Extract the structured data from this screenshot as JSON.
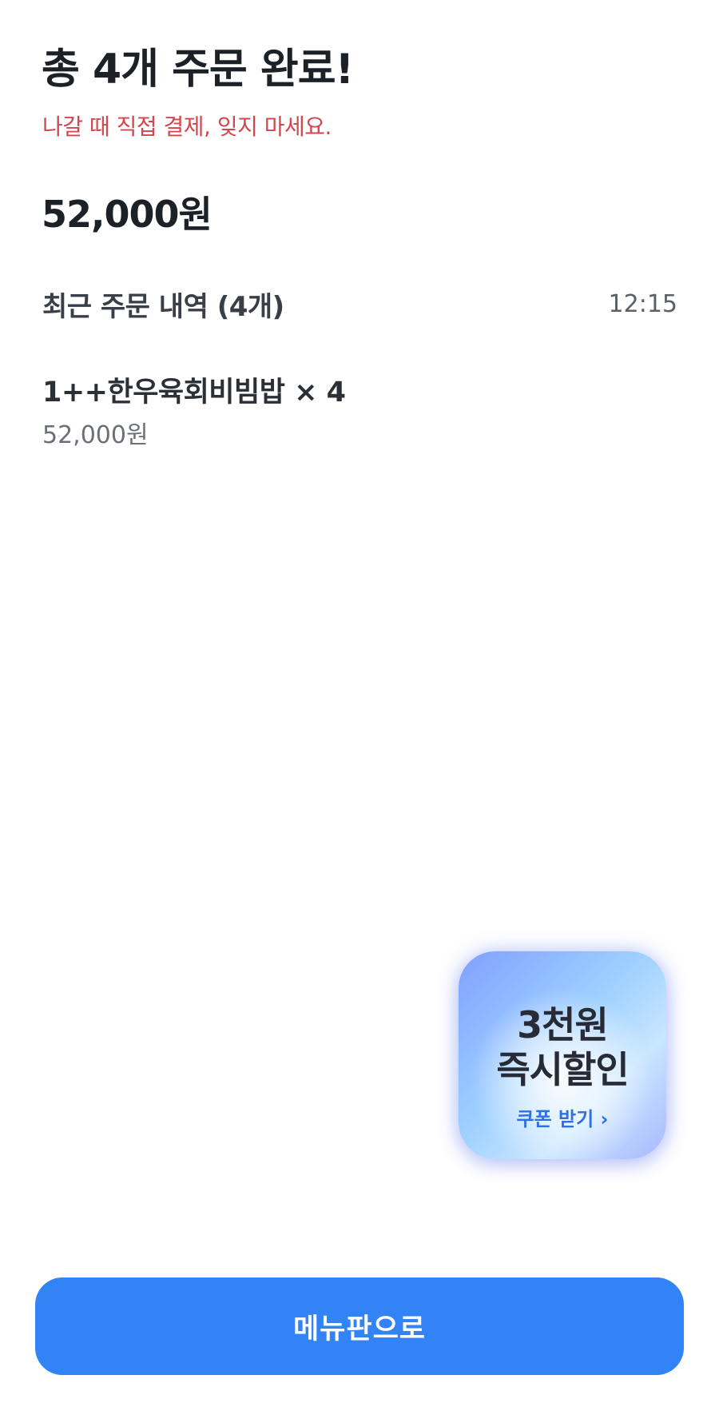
{
  "header": {
    "title": "총 4개 주문 완료!",
    "subtitle": "나갈 때 직접 결제, 잊지 마세요."
  },
  "summary": {
    "total_price": "52,000원"
  },
  "history": {
    "title": "최근 주문 내역 (4개)",
    "time": "12:15",
    "items": [
      {
        "name": "1++한우육회비빔밥 × 4",
        "price": "52,000원"
      }
    ]
  },
  "coupon": {
    "line1": "3천원",
    "line2": "즉시할인",
    "cta": "쿠폰 받기 ›"
  },
  "footer": {
    "button_label": "메뉴판으로"
  },
  "colors": {
    "accent": "#3283f6",
    "warning_text": "#d2464e"
  }
}
